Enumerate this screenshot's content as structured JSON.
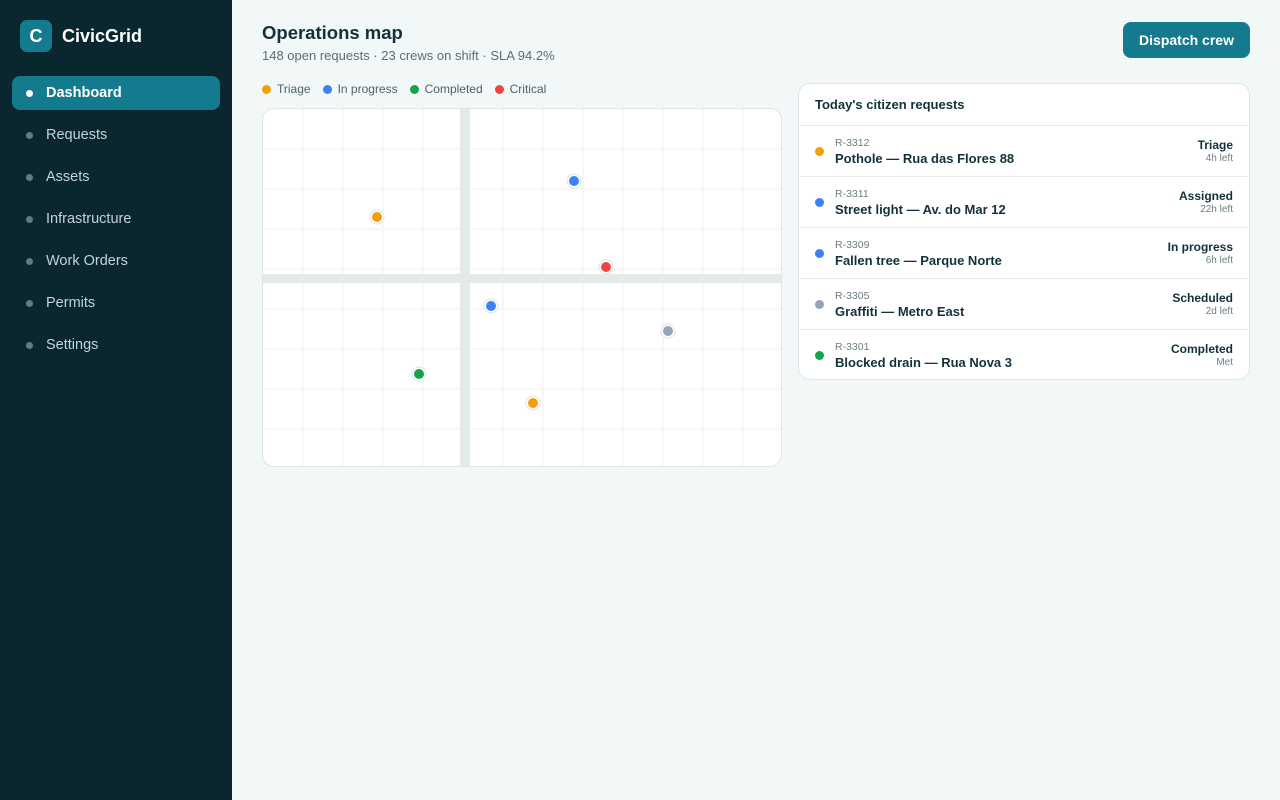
{
  "app": {
    "logo_letter": "C",
    "name": "CivicGrid"
  },
  "sidebar": {
    "items": [
      {
        "label": "Dashboard",
        "active": true
      },
      {
        "label": "Requests",
        "active": false
      },
      {
        "label": "Assets",
        "active": false
      },
      {
        "label": "Infrastructure",
        "active": false
      },
      {
        "label": "Work Orders",
        "active": false
      },
      {
        "label": "Permits",
        "active": false
      },
      {
        "label": "Settings",
        "active": false
      }
    ]
  },
  "header": {
    "title": "Operations map",
    "subtitle": "148 open requests · 23 crews on shift · SLA 94.2%",
    "action_label": "Dispatch crew"
  },
  "legend": [
    {
      "label": "Triage",
      "color": "#f59e0b"
    },
    {
      "label": "In progress",
      "color": "#3b82f6"
    },
    {
      "label": "Completed",
      "color": "#16a34a"
    },
    {
      "label": "Critical",
      "color": "#ef4444"
    }
  ],
  "map_markers": [
    {
      "status": "triage",
      "color": "#f59e0b"
    },
    {
      "status": "in-progress",
      "color": "#3b82f6"
    },
    {
      "status": "critical",
      "color": "#ef4444"
    },
    {
      "status": "in-progress",
      "color": "#3b82f6"
    },
    {
      "status": "scheduled",
      "color": "#94a3b8"
    },
    {
      "status": "completed",
      "color": "#16a34a"
    },
    {
      "status": "triage",
      "color": "#f59e0b"
    }
  ],
  "requests": {
    "title": "Today's citizen requests",
    "rows": [
      {
        "id": "R-3312",
        "title": "Pothole — Rua das Flores 88",
        "status": "Triage",
        "time": "4h left",
        "color": "#f59e0b"
      },
      {
        "id": "R-3311",
        "title": "Street light — Av. do Mar 12",
        "status": "Assigned",
        "time": "22h left",
        "color": "#3b82f6"
      },
      {
        "id": "R-3309",
        "title": "Fallen tree — Parque Norte",
        "status": "In progress",
        "time": "6h left",
        "color": "#3b82f6"
      },
      {
        "id": "R-3305",
        "title": "Graffiti — Metro East",
        "status": "Scheduled",
        "time": "2d left",
        "color": "#94a3b8"
      },
      {
        "id": "R-3301",
        "title": "Blocked drain — Rua Nova 3",
        "status": "Completed",
        "time": "Met",
        "color": "#16a34a"
      }
    ]
  }
}
